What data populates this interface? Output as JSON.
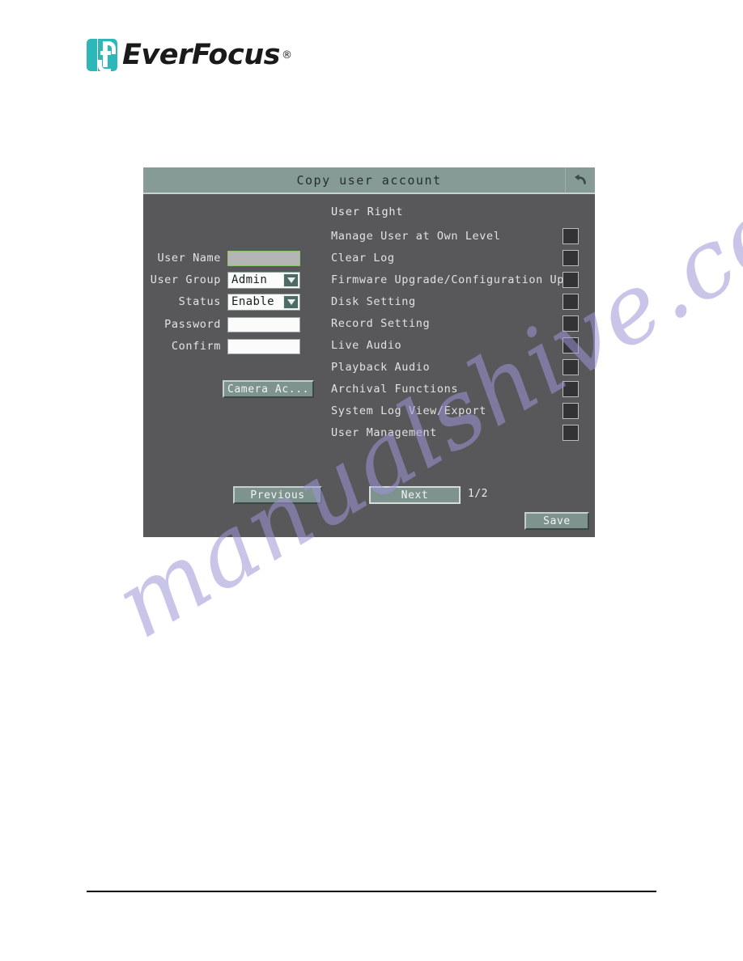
{
  "brand": {
    "name": "EverFocus",
    "trademark": "®",
    "logo_icon": "everfocus-f-mark-icon",
    "logo_color": "#2cb8b8"
  },
  "watermark": {
    "text": "manualshive.com",
    "color": "#9e96d8"
  },
  "dialog": {
    "title": "Copy user account",
    "back_icon": "back-arrow-icon",
    "colors": {
      "titlebar": "#869a96",
      "body": "#58585a",
      "button": "#7e928e",
      "field_focus_border": "#8fc472"
    },
    "form": {
      "fields": [
        {
          "label": "User  Name",
          "type": "text",
          "value": "",
          "placeholder": "",
          "state": "disabled"
        },
        {
          "label": "User  Group",
          "type": "select",
          "value": "Admin",
          "options": [
            "Admin"
          ]
        },
        {
          "label": "Status",
          "type": "select",
          "value": "Enable",
          "options": [
            "Enable"
          ]
        },
        {
          "label": "Password",
          "type": "password",
          "value": "",
          "placeholder": "",
          "state": "normal"
        },
        {
          "label": "Confirm",
          "type": "password",
          "value": "",
          "placeholder": "",
          "state": "normal"
        }
      ],
      "camera_access_label": "Camera  Ac..."
    },
    "rights": {
      "header": "User  Right",
      "items": [
        {
          "label": "Manage  User  at  Own  Level",
          "checked": false
        },
        {
          "label": "Clear  Log",
          "checked": false
        },
        {
          "label": "Firmware  Upgrade/Configuration  Uplo",
          "checked": false
        },
        {
          "label": "Disk  Setting",
          "checked": false
        },
        {
          "label": "Record  Setting",
          "checked": false
        },
        {
          "label": "Live  Audio",
          "checked": false
        },
        {
          "label": "Playback  Audio",
          "checked": false
        },
        {
          "label": "Archival  Functions",
          "checked": false
        },
        {
          "label": "System  Log  View/Export",
          "checked": false
        },
        {
          "label": "User  Management",
          "checked": false
        }
      ]
    },
    "actions": {
      "previous_label": "Previous",
      "next_label": "Next",
      "page_indicator": "1/2",
      "save_label": "Save"
    }
  }
}
